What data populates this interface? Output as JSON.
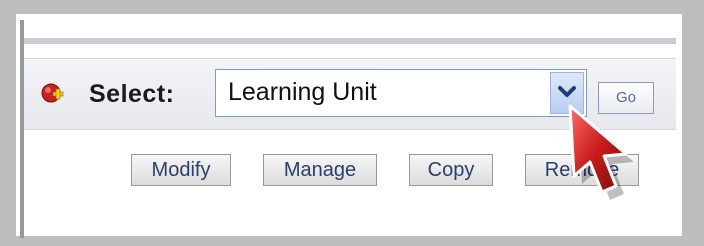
{
  "toolbar": {
    "select_label": "Select:",
    "dropdown_value": "Learning Unit",
    "go_label": "Go"
  },
  "actions": [
    {
      "label": "Modify"
    },
    {
      "label": "Manage"
    },
    {
      "label": "Copy"
    },
    {
      "label": "Remove"
    }
  ],
  "colors": {
    "add_icon_red": "#cc1f1f",
    "add_icon_plus": "#f2d21b",
    "cursor_red": "#c81b1b"
  }
}
